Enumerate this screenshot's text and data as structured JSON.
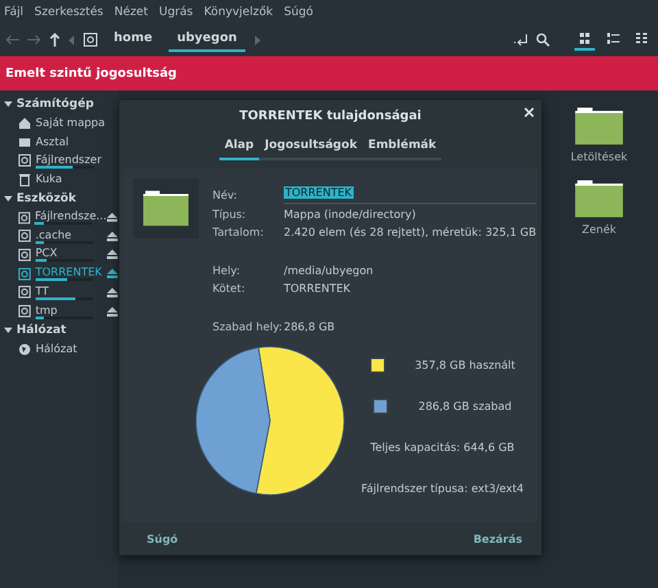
{
  "menu": [
    "Fájl",
    "Szerkesztés",
    "Nézet",
    "Ugrás",
    "Könyvjelzők",
    "Súgó"
  ],
  "toolbar": {
    "path": [
      {
        "label": "home",
        "selected": false
      },
      {
        "label": "ubyegon",
        "selected": true
      }
    ],
    "views": [
      {
        "selected": true
      },
      {
        "selected": false
      },
      {
        "selected": false
      }
    ]
  },
  "banner": "Emelt szintű jogosultság",
  "sidebar": [
    {
      "title": "Számítógép",
      "expanded": true,
      "items": [
        {
          "label": "Saját mappa",
          "kind": "home",
          "selected": false
        },
        {
          "label": "Asztal",
          "kind": "desktop",
          "selected": false
        },
        {
          "label": "Fájlrendszer",
          "kind": "drive",
          "level": 0.65,
          "selected": false
        },
        {
          "label": "Kuka",
          "kind": "trash",
          "selected": false
        }
      ]
    },
    {
      "title": "Eszközök",
      "expanded": true,
      "items": [
        {
          "label": "Fájlrendsze...",
          "kind": "drive",
          "level": 0.15,
          "eject": true,
          "selected": false
        },
        {
          "label": ".cache",
          "kind": "drive",
          "level": 0.15,
          "eject": true,
          "selected": false
        },
        {
          "label": "PCX",
          "kind": "drive",
          "level": 0.2,
          "eject": true,
          "selected": false
        },
        {
          "label": "TORRENTEK",
          "kind": "drive",
          "level": 0.55,
          "eject": true,
          "selected": true
        },
        {
          "label": "TT",
          "kind": "drive",
          "level": 0.7,
          "eject": true,
          "selected": false
        },
        {
          "label": "tmp",
          "kind": "drive",
          "level": 0.15,
          "eject": true,
          "selected": false
        }
      ]
    },
    {
      "title": "Hálózat",
      "expanded": true,
      "items": [
        {
          "label": "Hálózat",
          "kind": "network",
          "selected": false
        }
      ]
    }
  ],
  "files": [
    {
      "label": "Letöltések"
    },
    {
      "label": "Zenék"
    }
  ],
  "dialog": {
    "title": "TORRENTEK tulajdonságai",
    "tabs": [
      {
        "label": "Alap",
        "selected": true
      },
      {
        "label": "Jogosultságok",
        "selected": false
      },
      {
        "label": "Emblémák",
        "selected": false
      }
    ],
    "name_label": "Név:",
    "name_value": "TORRENTEK",
    "info_groups": [
      [
        {
          "label": "Típus:",
          "value": "Mappa (inode/directory)"
        },
        {
          "label": "Tartalom:",
          "value": "2.420 elem (és 28 rejtett), méretük: 325,1 GB"
        }
      ],
      [
        {
          "label": "Hely:",
          "value": "/media/ubyegon"
        },
        {
          "label": "Kötet:",
          "value": "TORRENTEK"
        }
      ],
      [
        {
          "label": "Szabad hely:",
          "value": "286,8 GB"
        }
      ]
    ],
    "chart_data": {
      "type": "pie",
      "categories": [
        "357,8 GB használt",
        "286,8 GB szabad"
      ],
      "values": [
        357.8,
        286.8
      ]
    },
    "capacity": "Teljes kapacitás: 644,6 GB",
    "fs_type": "Fájlrendszer típusa: ext3/ext4",
    "buttons": [
      "Súgó",
      "Bezárás"
    ]
  }
}
